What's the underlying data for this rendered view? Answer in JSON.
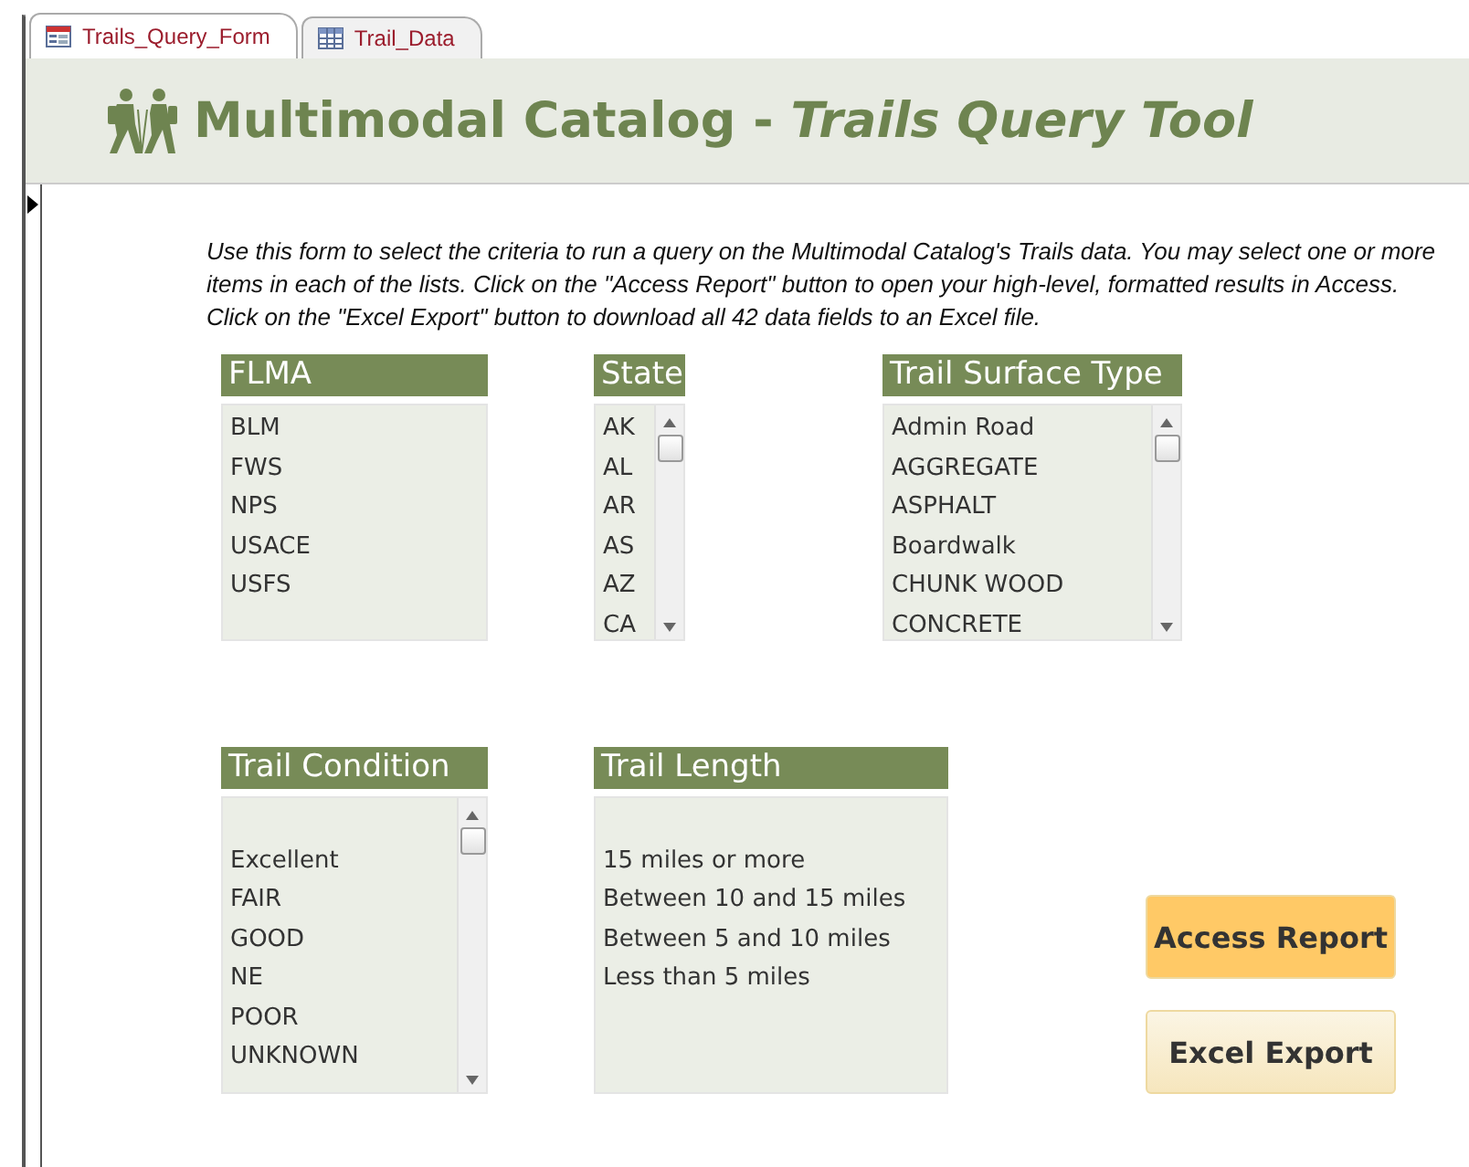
{
  "tabs": [
    {
      "label": "Trails_Query_Form",
      "kind": "form",
      "selected": true
    },
    {
      "label": "Trail_Data",
      "kind": "table",
      "selected": false
    }
  ],
  "header": {
    "title": "Multimodal Catalog - *Trails Query Tool*"
  },
  "instructions": "Use this form to select the criteria to run a query on the Multimodal Catalog's Trails data. You may select one or more items in each of the lists. Click on the \"Access Report\" button to open your high-level, formatted results in Access. Click on the \"Excel Export\" button to download all 42 data fields to an Excel file.",
  "lists": [
    {
      "label": "FLMA",
      "kind": "plain",
      "items": [
        "BLM",
        "FWS",
        "NPS",
        "USACE",
        "USFS"
      ]
    },
    {
      "label": "State",
      "kind": "scroll",
      "items": [
        "AK",
        "AL",
        "AR",
        "AS",
        "AZ",
        "CA"
      ]
    },
    {
      "label": "Trail Surface Type",
      "kind": "scroll",
      "items": [
        "Admin Road",
        "AGGREGATE",
        "ASPHALT",
        "Boardwalk",
        "CHUNK WOOD",
        "CONCRETE"
      ]
    },
    {
      "label": "Trail Condition",
      "kind": "scroll",
      "leading_blank": true,
      "items": [
        "Excellent",
        "FAIR",
        "GOOD",
        "NE",
        "POOR",
        "UNKNOWN"
      ]
    },
    {
      "label": "Trail Length",
      "kind": "plain",
      "leading_blank": true,
      "items": [
        "15 miles or more",
        "Between 10 and 15 miles",
        "Between 5 and 10 miles",
        "Less than 5 miles"
      ]
    }
  ],
  "buttons": [
    {
      "label": "Access Report",
      "kind": "primary"
    },
    {
      "label": "Excel Export",
      "kind": "secondary"
    }
  ]
}
